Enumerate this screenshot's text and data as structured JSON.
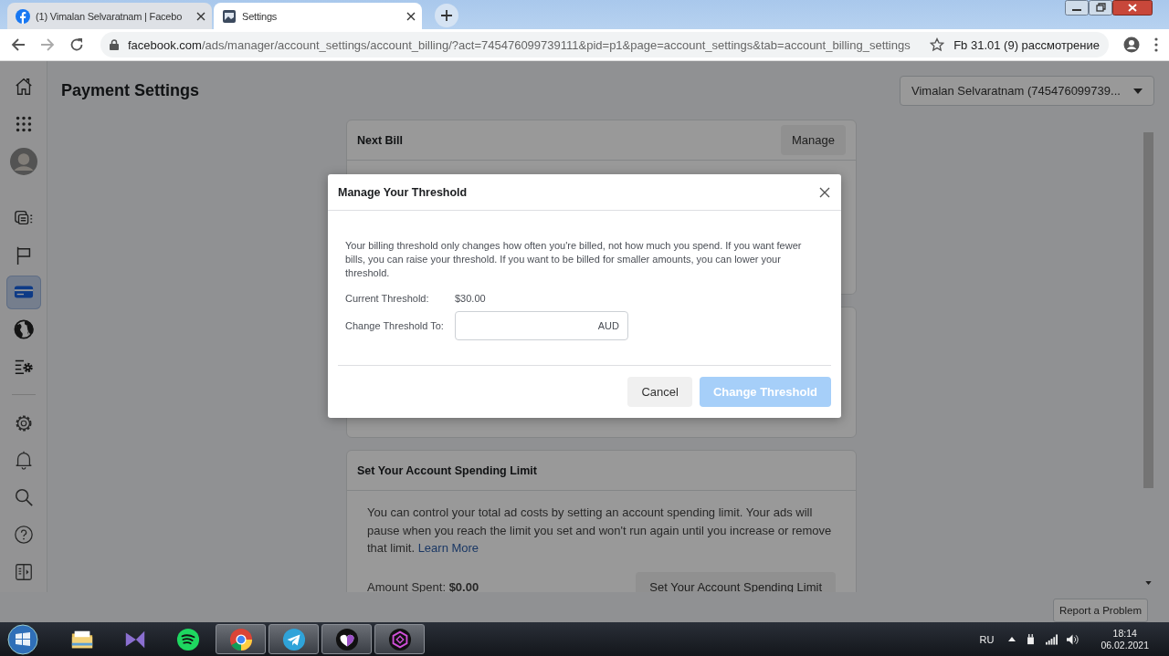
{
  "browser": {
    "tabs": [
      {
        "title": "(1) Vimalan Selvaratnam | Facebo",
        "selected": false
      },
      {
        "title": "Settings",
        "selected": true
      }
    ],
    "address": {
      "host": "facebook.com",
      "path": "/ads/manager/account_settings/account_billing/?act=745476099739111&pid=p1&page=account_settings&tab=account_billing_settings"
    },
    "bookmark": "Fb 31.01 (9) рассмотрение"
  },
  "sidebar": {
    "items": [
      {
        "selected": false
      },
      {
        "selected": false
      },
      {
        "selected": false
      },
      {
        "selected": false
      },
      {
        "selected": false
      },
      {
        "selected": true
      },
      {
        "selected": false
      },
      {
        "selected": false
      },
      {
        "selected": false
      },
      {
        "selected": false
      },
      {
        "selected": false
      },
      {
        "selected": false
      },
      {
        "selected": false
      }
    ]
  },
  "page": {
    "title": "Payment Settings",
    "account": "Vimalan Selvaratnam (745476099739..."
  },
  "cards": [
    {
      "kind": "next_bill",
      "title": "Next Bill",
      "button": "Manage"
    },
    {
      "kind": "hidden"
    },
    {
      "kind": "spending_limit",
      "title": "Set Your Account Spending Limit",
      "text": "You can control your total ad costs by setting an account spending limit. Your ads will pause when you reach the limit you set and won't run again until you increase or remove that limit.",
      "link": "Learn More",
      "amount": "Amount Spent: **$0.00**",
      "button": "Set Your Account Spending Limit"
    }
  ],
  "report_button": "Report a Problem",
  "dialog": {
    "title": "Manage Your Threshold",
    "text": "Your billing threshold only changes how often you're billed, not how much you spend. If you want fewer bills, you can raise your threshold. If you want to be billed for smaller amounts, you can lower your threshold.",
    "current_label": "Current Threshold:",
    "current_value": "$30.00",
    "change_label": "Change Threshold To:",
    "currency": "AUD",
    "buttons": [
      {
        "label": "Cancel",
        "kind": "secondary",
        "disabled": false
      },
      {
        "label": "Change Threshold",
        "kind": "primary",
        "disabled": true
      }
    ]
  },
  "taskbar": {
    "apps": [
      {
        "running": false
      },
      {
        "running": false
      },
      {
        "running": false
      },
      {
        "running": true
      },
      {
        "running": true
      },
      {
        "running": true
      },
      {
        "running": true
      }
    ],
    "language": "RU",
    "time": "18:14",
    "date": "06.02.2021"
  }
}
